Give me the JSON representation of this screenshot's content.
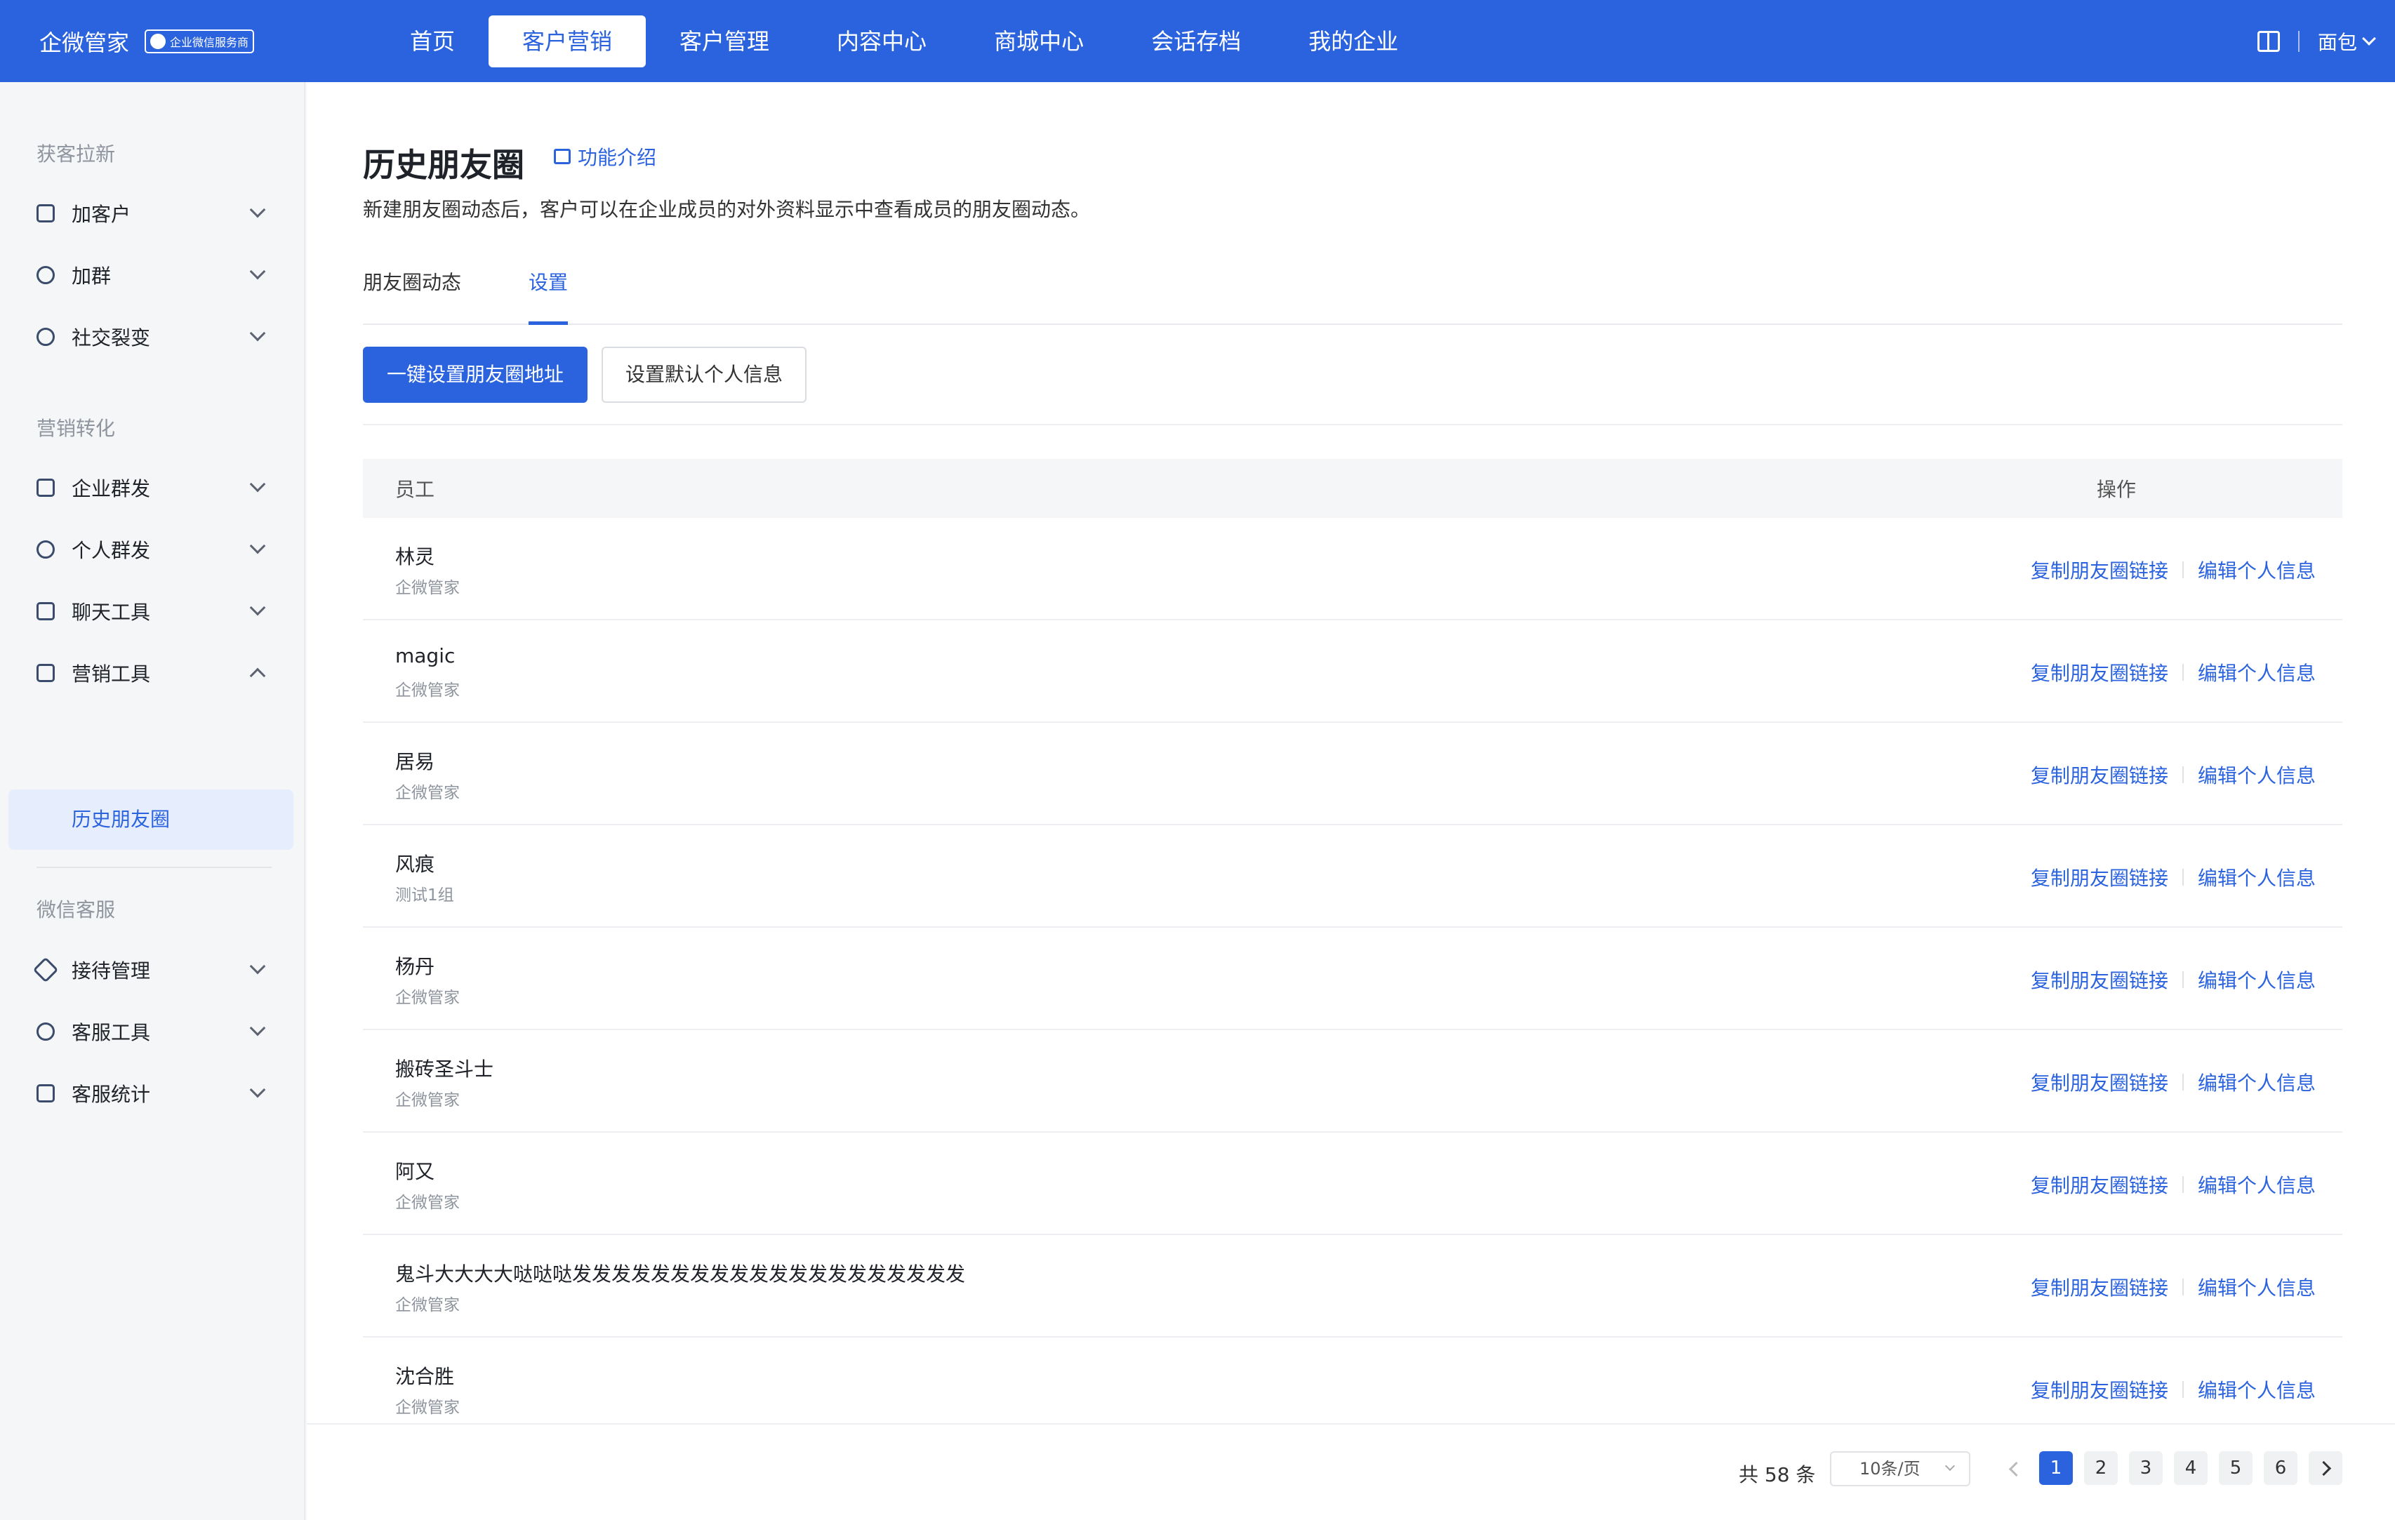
{
  "topbar": {
    "brand_name": "企微管家",
    "brand_badge": "企业微信服务商",
    "nav": [
      "首页",
      "客户营销",
      "客户管理",
      "内容中心",
      "商城中心",
      "会话存档",
      "我的企业"
    ],
    "active_nav": "客户营销",
    "user_name": "面包"
  },
  "sidebar": {
    "sections": [
      {
        "title": "获客拉新",
        "items": [
          "加客户",
          "加群",
          "社交裂变"
        ]
      },
      {
        "title": "营销转化",
        "items": [
          "企业群发",
          "个人群发",
          "聊天工具",
          "营销工具"
        ]
      },
      {
        "title": "微信客服",
        "items": [
          "接待管理",
          "客服工具",
          "客服统计"
        ]
      }
    ],
    "active_sub": "历史朋友圈"
  },
  "main": {
    "title": "历史朋友圈",
    "intro_link": "功能介绍",
    "description": "新建朋友圈动态后，客户可以在企业成员的对外资料显示中查看成员的朋友圈动态。",
    "tabs": [
      "朋友圈动态",
      "设置"
    ],
    "active_tab": "设置",
    "btn_primary": "一键设置朋友圈地址",
    "btn_default": "设置默认个人信息",
    "table": {
      "col_staff": "员工",
      "col_action": "操作",
      "action_copy": "复制朋友圈链接",
      "action_edit": "编辑个人信息",
      "rows": [
        {
          "name": "林灵",
          "group": "企微管家"
        },
        {
          "name": "magic",
          "group": "企微管家"
        },
        {
          "name": "居易",
          "group": "企微管家"
        },
        {
          "name": "风痕",
          "group": "测试1组"
        },
        {
          "name": "杨丹",
          "group": "企微管家"
        },
        {
          "name": "搬砖圣斗士",
          "group": "企微管家"
        },
        {
          "name": "阿又",
          "group": "企微管家"
        },
        {
          "name": "鬼斗大大大大哒哒哒发发发发发发发发发发发发发发发发发发发发",
          "group": "企微管家"
        },
        {
          "name": "沈合胜",
          "group": "企微管家"
        }
      ]
    }
  },
  "pagination": {
    "total": "共 58 条",
    "page_size": "10条/页",
    "pages": [
      "1",
      "2",
      "3",
      "4",
      "5",
      "6"
    ],
    "current": "1"
  },
  "colors": {
    "primary": "#2b63de",
    "sidebar_bg": "#f5f6f8"
  }
}
